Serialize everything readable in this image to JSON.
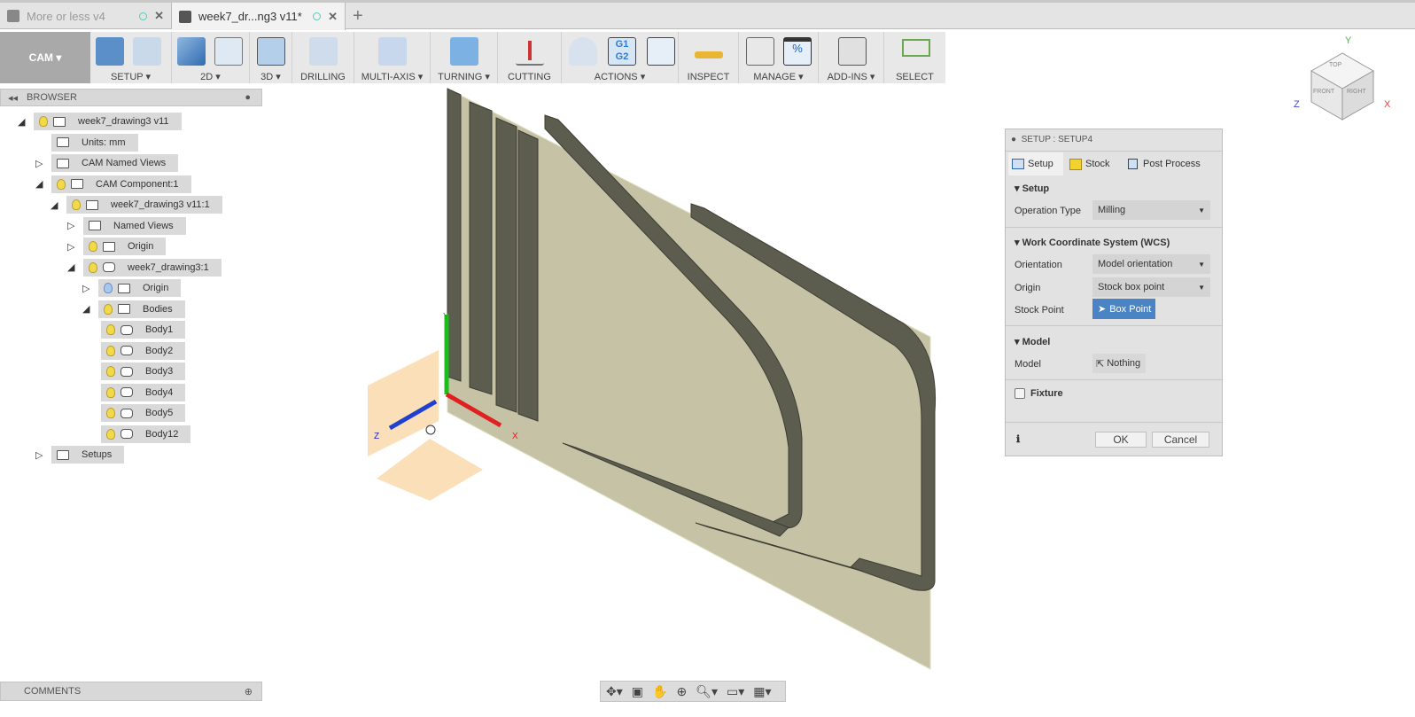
{
  "tabs": [
    {
      "label": "More or less v4",
      "active": false
    },
    {
      "label": "week7_dr...ng3 v11*",
      "active": true
    }
  ],
  "toolbar": {
    "workspace": "CAM ▾",
    "groups": [
      "SETUP ▾",
      "2D ▾",
      "3D ▾",
      "DRILLING",
      "MULTI-AXIS ▾",
      "TURNING ▾",
      "CUTTING",
      "ACTIONS ▾",
      "INSPECT",
      "MANAGE ▾",
      "ADD-INS ▾",
      "SELECT"
    ],
    "actions_icons": [
      "G1",
      "G2"
    ],
    "manage_icon": "%"
  },
  "browser": {
    "title": "BROWSER",
    "items": [
      {
        "label": "week7_drawing3 v11",
        "level": 0,
        "exp": "open",
        "bulb": "y",
        "icon": "component"
      },
      {
        "label": "Units: mm",
        "level": 1,
        "exp": "none",
        "bulb": "",
        "icon": "doc"
      },
      {
        "label": "CAM Named Views",
        "level": 1,
        "exp": "closed",
        "bulb": "",
        "icon": "folder"
      },
      {
        "label": "CAM Component:1",
        "level": 1,
        "exp": "open",
        "bulb": "y",
        "icon": "component"
      },
      {
        "label": "week7_drawing3 v11:1",
        "level": 2,
        "exp": "open",
        "bulb": "y",
        "icon": "component"
      },
      {
        "label": "Named Views",
        "level": 3,
        "exp": "closed",
        "bulb": "",
        "icon": "folder"
      },
      {
        "label": "Origin",
        "level": 3,
        "exp": "closed",
        "bulb": "y",
        "icon": "folder"
      },
      {
        "label": "week7_drawing3:1",
        "level": 3,
        "exp": "open",
        "bulb": "y",
        "icon": "body"
      },
      {
        "label": "Origin",
        "level": 4,
        "exp": "closed",
        "bulb": "b",
        "icon": "folder"
      },
      {
        "label": "Bodies",
        "level": 4,
        "exp": "open",
        "bulb": "y",
        "icon": "folder"
      },
      {
        "label": "Body1",
        "level": 5,
        "exp": "none",
        "bulb": "y",
        "icon": "body"
      },
      {
        "label": "Body2",
        "level": 5,
        "exp": "none",
        "bulb": "y",
        "icon": "body"
      },
      {
        "label": "Body3",
        "level": 5,
        "exp": "none",
        "bulb": "y",
        "icon": "body"
      },
      {
        "label": "Body4",
        "level": 5,
        "exp": "none",
        "bulb": "y",
        "icon": "body"
      },
      {
        "label": "Body5",
        "level": 5,
        "exp": "none",
        "bulb": "y",
        "icon": "body"
      },
      {
        "label": "Body12",
        "level": 5,
        "exp": "none",
        "bulb": "y",
        "icon": "body"
      },
      {
        "label": "Setups",
        "level": 1,
        "exp": "closed",
        "bulb": "",
        "icon": "setups"
      }
    ]
  },
  "comments": {
    "title": "COMMENTS"
  },
  "viewcube": {
    "top": "TOP",
    "front": "FRONT",
    "right": "RIGHT",
    "x": "X",
    "y": "Y",
    "z": "Z"
  },
  "axes": {
    "x": "X",
    "y": "Y",
    "z": "Z"
  },
  "dialog": {
    "title": "SETUP : SETUP4",
    "tabs": [
      "Setup",
      "Stock",
      "Post Process"
    ],
    "setup_section": "Setup",
    "operation_type_label": "Operation Type",
    "operation_type": "Milling",
    "wcs_section": "Work Coordinate System (WCS)",
    "orientation_label": "Orientation",
    "orientation": "Model orientation",
    "origin_label": "Origin",
    "origin": "Stock box point",
    "stock_point_label": "Stock Point",
    "stock_point": "Box Point",
    "model_section": "Model",
    "model_label": "Model",
    "model": "Nothing",
    "fixture_label": "Fixture",
    "fixture_checked": false,
    "ok": "OK",
    "cancel": "Cancel"
  }
}
